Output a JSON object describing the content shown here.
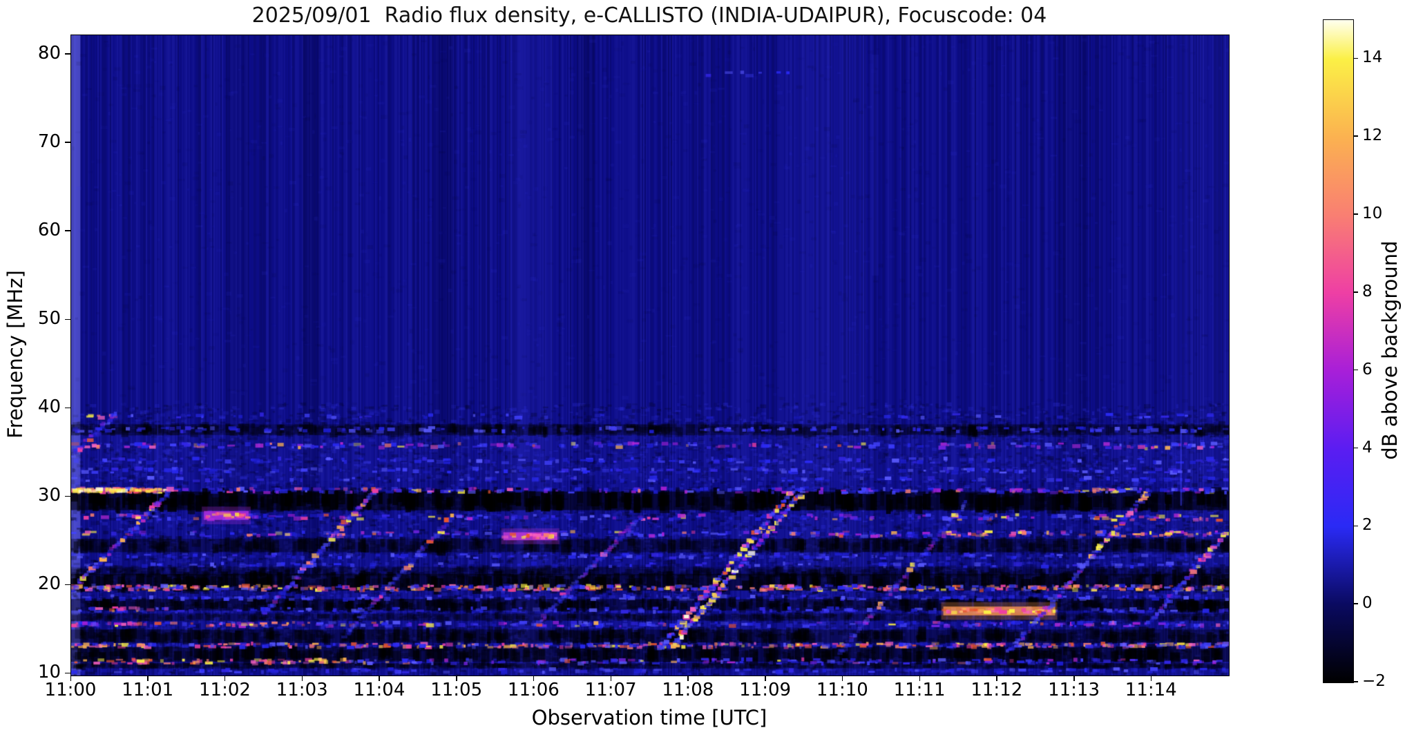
{
  "chart_data": {
    "type": "heatmap",
    "title": "2025/09/01  Radio flux density, e-CALLISTO (INDIA-UDAIPUR), Focuscode: 04",
    "xlabel": "Observation time [UTC]",
    "ylabel": "Frequency [MHz]",
    "colorbar_label": "dB above background",
    "x_ticks": [
      "11:00",
      "11:01",
      "11:02",
      "11:03",
      "11:04",
      "11:05",
      "11:06",
      "11:07",
      "11:08",
      "11:09",
      "11:10",
      "11:11",
      "11:12",
      "11:13",
      "11:14"
    ],
    "x_tick_minutes": [
      0,
      1,
      2,
      3,
      4,
      5,
      6,
      7,
      8,
      9,
      10,
      11,
      12,
      13,
      14
    ],
    "x_range_minutes": [
      0,
      15
    ],
    "y_ticks": [
      "80",
      "70",
      "60",
      "50",
      "40",
      "30",
      "20",
      "10"
    ],
    "y_tick_values": [
      80,
      70,
      60,
      50,
      40,
      30,
      20,
      10
    ],
    "y_range_mhz": [
      9.8,
      82.2
    ],
    "colorbar_tick_labels": [
      "14",
      "12",
      "10",
      "8",
      "6",
      "4",
      "2",
      "0",
      "−2"
    ],
    "colorbar_tick_values": [
      14,
      12,
      10,
      8,
      6,
      4,
      2,
      0,
      -2
    ],
    "colorbar_range_db": [
      -2,
      15
    ],
    "legend_position": "right-colorbar",
    "grid": false,
    "colormap": {
      "stops": [
        [
          -2,
          "#000000"
        ],
        [
          0,
          "#0a0a60"
        ],
        [
          2,
          "#2a2af5"
        ],
        [
          4,
          "#5b1df2"
        ],
        [
          6,
          "#a81fd8"
        ],
        [
          8,
          "#ee3fa4"
        ],
        [
          10,
          "#f97f72"
        ],
        [
          12,
          "#fbb250"
        ],
        [
          14,
          "#fbf046"
        ],
        [
          15,
          "#ffffee"
        ]
      ]
    },
    "features": {
      "base_color": "#0d0d88",
      "noise_seed": 7,
      "palettes": {
        "blue": [
          "#1e1ed2",
          "#2a2af5",
          "#4343ff",
          "#5b5bff",
          "#3327e6"
        ],
        "hot": [
          "#ee3fa4",
          "#f97f72",
          "#fbb250",
          "#fbf046",
          "#e8552f",
          "#f760c0"
        ],
        "yellow": [
          "#fbf046",
          "#ffe14a",
          "#fffdda"
        ],
        "purple": [
          "#7a25e8",
          "#b829d6",
          "#a81fd8"
        ]
      },
      "haze_rects": [
        {
          "f0": 31.8,
          "f1": 37.8,
          "c": "#3232dc",
          "a": 0.1
        },
        {
          "f0": 9.8,
          "f1": 31.8,
          "c": "#2828c8",
          "a": 0.06
        }
      ],
      "vertical_patches": [
        {
          "t0": 0,
          "t1": 0.12,
          "c": "#8080ff",
          "a": 0.5
        },
        {
          "t0": 2.0,
          "t1": 2.3,
          "c": "#000030",
          "a": 0.14
        },
        {
          "t0": 3.0,
          "t1": 3.22,
          "c": "#000030",
          "a": 0.25
        },
        {
          "t0": 4.72,
          "t1": 4.95,
          "c": "#000030",
          "a": 0.22
        },
        {
          "t0": 6.55,
          "t1": 6.78,
          "c": "#000030",
          "a": 0.18
        },
        {
          "t0": 12.8,
          "t1": 13.15,
          "c": "#000030",
          "a": 0.13
        },
        {
          "t0": 5.66,
          "t1": 6.25,
          "c": "#5050ff",
          "a": 0.1
        },
        {
          "t0": 9.4,
          "t1": 10.3,
          "c": "#5050ff",
          "a": 0.08
        },
        {
          "t0": 14.25,
          "t1": 14.97,
          "c": "#5050ff",
          "a": 0.08
        }
      ],
      "vertical_lines": [
        {
          "t": 14.38,
          "f0": 29,
          "f1": 38,
          "c": "#4646ff",
          "a": 0.55,
          "w": 2
        },
        {
          "t": 1.12,
          "f0": 27,
          "f1": 39.5,
          "c": "#3a3aee",
          "a": 0.3,
          "w": 2
        },
        {
          "t": 10.42,
          "f0": 55,
          "f1": 80,
          "c": "#4242f2",
          "a": 0.1,
          "w": 10
        }
      ],
      "mottle": [
        {
          "fmin": 9.8,
          "fmax": 31.8,
          "n": 6500,
          "aDark": 0.4,
          "aBlue": 0.3
        },
        {
          "fmin": 31.8,
          "fmax": 40.5,
          "n": 2600,
          "aDark": 0.3,
          "aBlue": 0.25
        },
        {
          "fmin": 40.5,
          "fmax": 82.0,
          "n": 1600,
          "aDark": 0.1,
          "aBlue": 0.1
        }
      ],
      "dark_bands": [
        {
          "f": 37.6,
          "h": 0.6,
          "t0": 0,
          "t1": 15,
          "a": 0.45
        },
        {
          "f": 29.55,
          "h": 1.05,
          "t0": 0,
          "t1": 15,
          "a": 0.85
        },
        {
          "f": 24.5,
          "h": 0.75,
          "t0": 0,
          "t1": 15,
          "a": 0.5
        },
        {
          "f": 21.6,
          "h": 0.5,
          "t0": 0,
          "t1": 15,
          "a": 0.3
        },
        {
          "f": 20.35,
          "h": 0.95,
          "t0": 0,
          "t1": 15,
          "a": 0.7
        },
        {
          "f": 17.8,
          "h": 0.65,
          "t0": 0,
          "t1": 15,
          "a": 0.6
        },
        {
          "f": 16.4,
          "h": 0.4,
          "t0": 0,
          "t1": 15,
          "a": 0.35
        },
        {
          "f": 14.25,
          "h": 0.75,
          "t0": 0,
          "t1": 15,
          "a": 0.55
        },
        {
          "f": 12.2,
          "h": 0.85,
          "t0": 0,
          "t1": 15,
          "a": 0.65
        },
        {
          "f": 10.9,
          "h": 0.3,
          "t0": 0,
          "t1": 15,
          "a": 0.4
        }
      ],
      "speckle_bands": [
        {
          "f": 39.15,
          "h": 0.4,
          "t0": 0,
          "t1": 15,
          "d": 3,
          "p": "blue"
        },
        {
          "f": 39.1,
          "h": 0.45,
          "t0": 0.02,
          "t1": 0.6,
          "d": 9,
          "p": "hot"
        },
        {
          "f": 37.6,
          "h": 0.45,
          "t0": 0,
          "t1": 15,
          "d": 10,
          "p": "blue"
        },
        {
          "f": 35.8,
          "h": 0.5,
          "t0": 0,
          "t1": 15,
          "d": 14,
          "p": "mix"
        },
        {
          "f": 35.8,
          "h": 0.5,
          "t0": 0.02,
          "t1": 0.5,
          "d": 12,
          "p": "hot"
        },
        {
          "f": 35.6,
          "h": 0.5,
          "t0": 13.7,
          "t1": 14.35,
          "d": 9,
          "p": "hot"
        },
        {
          "f": 34.1,
          "h": 0.5,
          "t0": 0,
          "t1": 15,
          "d": 9,
          "p": "blue"
        },
        {
          "f": 33.0,
          "h": 0.5,
          "t0": 0,
          "t1": 15,
          "d": 11,
          "p": "blue"
        },
        {
          "f": 32.0,
          "h": 0.4,
          "t0": 0,
          "t1": 15,
          "d": 6,
          "p": "blue"
        },
        {
          "f": 30.72,
          "h": 0.5,
          "t0": 0,
          "t1": 15,
          "d": 16,
          "p": "mix"
        },
        {
          "f": 30.72,
          "h": 0.45,
          "t0": 0,
          "t1": 1.35,
          "d": 60,
          "p": "hot"
        },
        {
          "f": 30.75,
          "h": 0.3,
          "t0": 0,
          "t1": 1.35,
          "d": 26,
          "p": "yellow"
        },
        {
          "f": 30.7,
          "h": 0.4,
          "t0": 13.1,
          "t1": 13.75,
          "d": 10,
          "p": "hot"
        },
        {
          "f": 27.7,
          "h": 0.55,
          "t0": 0,
          "t1": 15,
          "d": 13,
          "p": "mix"
        },
        {
          "f": 27.6,
          "h": 0.5,
          "t0": 13.25,
          "t1": 15,
          "d": 9,
          "p": "hot"
        },
        {
          "f": 25.8,
          "h": 0.55,
          "t0": 0,
          "t1": 15,
          "d": 13,
          "p": "mix"
        },
        {
          "f": 25.85,
          "h": 0.5,
          "t0": 11.3,
          "t1": 12.4,
          "d": 18,
          "p": "hot"
        },
        {
          "f": 25.8,
          "h": 0.5,
          "t0": 13.7,
          "t1": 15,
          "d": 15,
          "p": "hot"
        },
        {
          "f": 23.3,
          "h": 0.5,
          "t0": 0,
          "t1": 15,
          "d": 10,
          "p": "blue"
        },
        {
          "f": 22.3,
          "h": 0.4,
          "t0": 0,
          "t1": 15,
          "d": 6,
          "p": "blue"
        },
        {
          "f": 19.7,
          "h": 0.5,
          "t0": 0,
          "t1": 15,
          "d": 22,
          "p": "hot"
        },
        {
          "f": 19.7,
          "h": 0.55,
          "t0": 0,
          "t1": 15,
          "d": 12,
          "p": "blue"
        },
        {
          "f": 18.6,
          "h": 0.45,
          "t0": 0,
          "t1": 15,
          "d": 10,
          "p": "blue"
        },
        {
          "f": 17.2,
          "h": 0.45,
          "t0": 0,
          "t1": 15,
          "d": 10,
          "p": "blue"
        },
        {
          "f": 17.3,
          "h": 0.4,
          "t0": 0.25,
          "t1": 1.3,
          "d": 10,
          "p": "hot"
        },
        {
          "f": 15.6,
          "h": 0.45,
          "t0": 0,
          "t1": 15,
          "d": 16,
          "p": "mix"
        },
        {
          "f": 15.6,
          "h": 0.4,
          "t0": 0,
          "t1": 3.1,
          "d": 10,
          "p": "hot"
        },
        {
          "f": 13.2,
          "h": 0.45,
          "t0": 0,
          "t1": 15,
          "d": 16,
          "p": "hot"
        },
        {
          "f": 13.2,
          "h": 0.5,
          "t0": 0,
          "t1": 15,
          "d": 8,
          "p": "blue"
        },
        {
          "f": 11.4,
          "h": 0.5,
          "t0": 0,
          "t1": 3.6,
          "d": 19,
          "p": "hot"
        },
        {
          "f": 11.4,
          "h": 0.5,
          "t0": 3.6,
          "t1": 15,
          "d": 14,
          "p": "mix"
        },
        {
          "f": 10.35,
          "h": 0.4,
          "t0": 0,
          "t1": 15,
          "d": 8,
          "p": "blue"
        },
        {
          "f": 77.8,
          "h": 0.5,
          "t0": 8.15,
          "t1": 9.3,
          "d": 6,
          "p": "blue"
        }
      ],
      "blobs": [
        {
          "t0": 1.72,
          "t1": 2.3,
          "f": 27.9,
          "h": 0.5,
          "c": "#b32fe2",
          "a": 0.8
        },
        {
          "t0": 5.6,
          "t1": 6.3,
          "f": 25.55,
          "h": 0.45,
          "c": "#c438da",
          "a": 0.8
        },
        {
          "t0": 11.3,
          "t1": 12.75,
          "f": 17.1,
          "h": 0.5,
          "c": "#f8944e",
          "a": 0.8
        }
      ],
      "drift_streaks": [
        {
          "t0": 0.0,
          "f0": 19.3,
          "t1": 1.3,
          "f1": 30.8,
          "s": "med"
        },
        {
          "t0": 0.02,
          "f0": 34.8,
          "t1": 0.6,
          "f1": 39.5,
          "s": "med"
        },
        {
          "t0": 2.5,
          "f0": 16.8,
          "t1": 3.95,
          "f1": 30.9,
          "s": "med",
          "hotTop": true
        },
        {
          "t0": 3.55,
          "f0": 14.3,
          "t1": 4.95,
          "f1": 27.8,
          "s": "faint"
        },
        {
          "t0": 6.0,
          "f0": 15.3,
          "t1": 7.35,
          "f1": 27.6,
          "s": "faint"
        },
        {
          "t0": 7.62,
          "f0": 12.8,
          "t1": 9.38,
          "f1": 31.0,
          "s": "bright",
          "double": true
        },
        {
          "t0": 9.95,
          "f0": 12.3,
          "t1": 11.6,
          "f1": 29.3,
          "s": "faint"
        },
        {
          "t0": 12.15,
          "f0": 12.4,
          "t1": 13.98,
          "f1": 30.7,
          "s": "med",
          "hotTop": true
        },
        {
          "t0": 13.95,
          "f0": 15.5,
          "t1": 14.95,
          "f1": 25.8,
          "s": "med",
          "hotTop": true
        }
      ]
    }
  }
}
